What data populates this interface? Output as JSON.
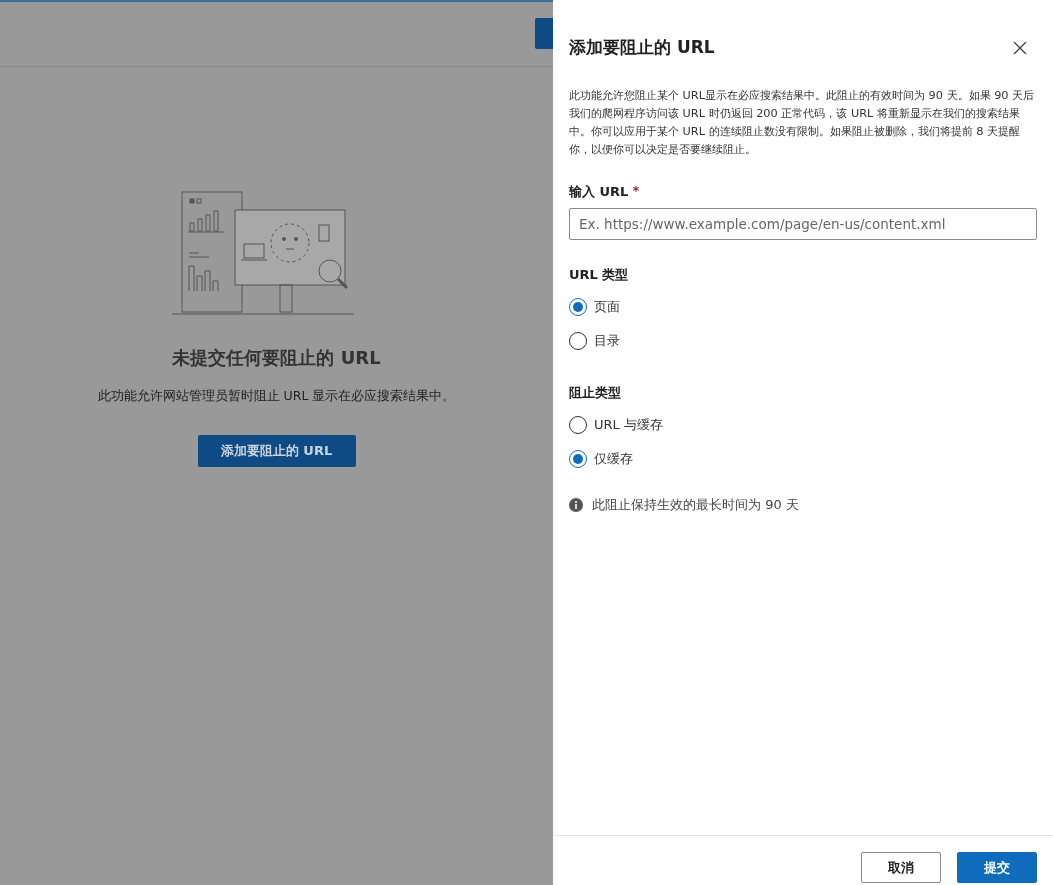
{
  "background_page": {
    "empty_state": {
      "title": "未提交任何要阻止的 URL",
      "description": "此功能允许网站管理员暂时阻止 URL 显示在必应搜索结果中。",
      "button": "添加要阻止的 URL"
    }
  },
  "panel": {
    "title": "添加要阻止的 URL",
    "description": "此功能允许您阻止某个 URL显示在必应搜索结果中。此阻止的有效时间为 90 天。如果 90 天后我们的爬网程序访问该 URL 时仍返回 200 正常代码，该 URL 将重新显示在我们的搜索结果中。你可以应用于某个 URL 的连续阻止数没有限制。如果阻止被删除，我们将提前 8 天提醒你，以便你可以决定是否要继续阻止。",
    "url_field": {
      "label": "输入 URL",
      "required_mark": "*",
      "placeholder": "Ex. https://www.example.com/page/en-us/content.xml"
    },
    "url_type": {
      "label": "URL 类型",
      "options": [
        {
          "label": "页面",
          "selected": true
        },
        {
          "label": "目录",
          "selected": false
        }
      ]
    },
    "block_type": {
      "label": "阻止类型",
      "options": [
        {
          "label": "URL 与缓存",
          "selected": false
        },
        {
          "label": "仅缓存",
          "selected": true
        }
      ]
    },
    "info_note": "此阻止保持生效的最长时间为 90 天",
    "buttons": [
      {
        "label": "取消",
        "kind": "secondary"
      },
      {
        "label": "提交",
        "kind": "primary"
      }
    ]
  }
}
